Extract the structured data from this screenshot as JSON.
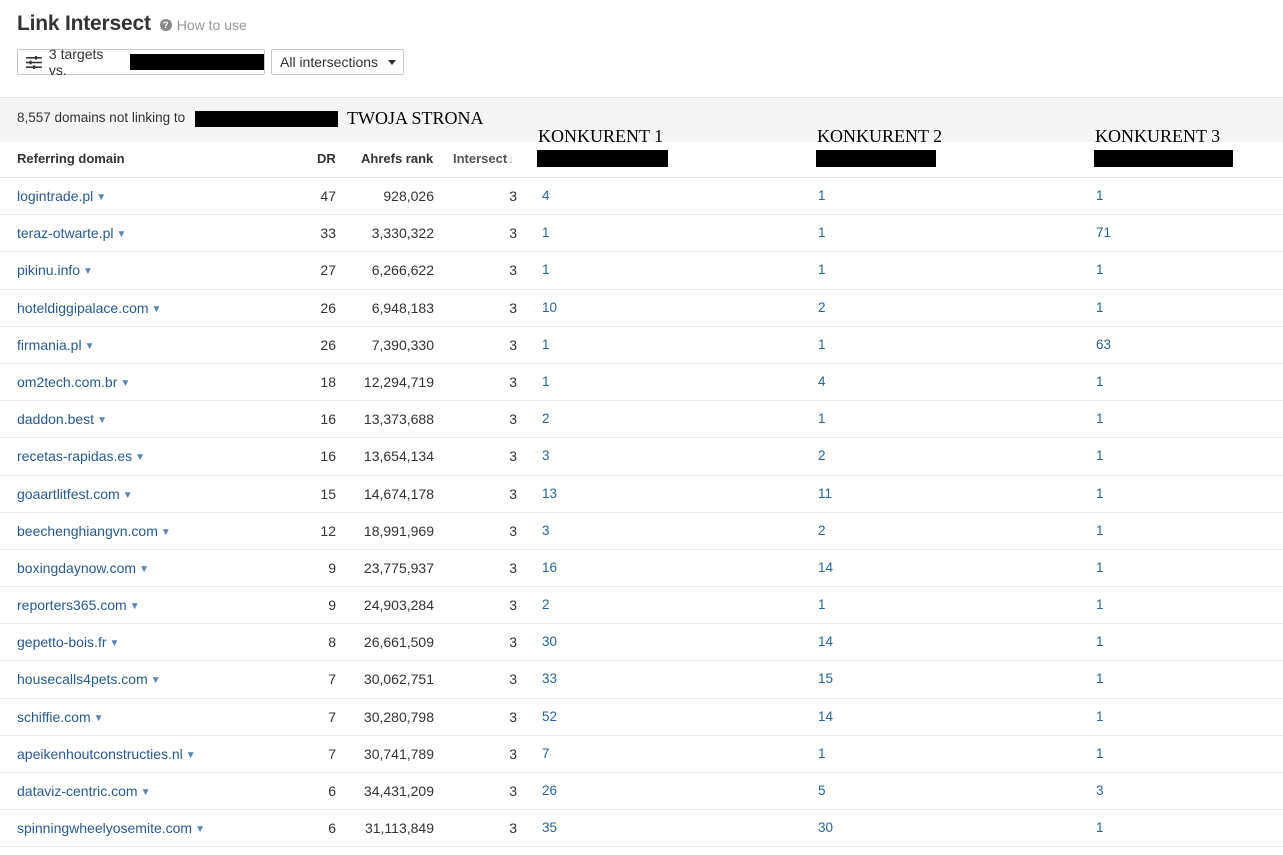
{
  "header": {
    "title": "Link Intersect",
    "help_icon": "?",
    "help_label": "How to use"
  },
  "toolbar": {
    "targets_label": "3 targets vs.",
    "filter_label": "All intersections"
  },
  "summary": {
    "text": "8,557 domains not linking to",
    "own_site_label": "TWOJA STRONA"
  },
  "competitors": [
    "KONKURENT 1",
    "KONKURENT 2",
    "KONKURENT 3"
  ],
  "columns": {
    "domain": "Referring domain",
    "dr": "DR",
    "rank": "Ahrefs rank",
    "intersect": "Intersect",
    "sort_glyph": "↓"
  },
  "rows": [
    {
      "domain": "logintrade.pl",
      "dr": "47",
      "rank": "928,026",
      "intersect": "3",
      "c1": "4",
      "c2": "1",
      "c3": "1"
    },
    {
      "domain": "teraz-otwarte.pl",
      "dr": "33",
      "rank": "3,330,322",
      "intersect": "3",
      "c1": "1",
      "c2": "1",
      "c3": "71"
    },
    {
      "domain": "pikinu.info",
      "dr": "27",
      "rank": "6,266,622",
      "intersect": "3",
      "c1": "1",
      "c2": "1",
      "c3": "1"
    },
    {
      "domain": "hoteldiggipalace.com",
      "dr": "26",
      "rank": "6,948,183",
      "intersect": "3",
      "c1": "10",
      "c2": "2",
      "c3": "1"
    },
    {
      "domain": "firmania.pl",
      "dr": "26",
      "rank": "7,390,330",
      "intersect": "3",
      "c1": "1",
      "c2": "1",
      "c3": "63"
    },
    {
      "domain": "om2tech.com.br",
      "dr": "18",
      "rank": "12,294,719",
      "intersect": "3",
      "c1": "1",
      "c2": "4",
      "c3": "1"
    },
    {
      "domain": "daddon.best",
      "dr": "16",
      "rank": "13,373,688",
      "intersect": "3",
      "c1": "2",
      "c2": "1",
      "c3": "1"
    },
    {
      "domain": "recetas-rapidas.es",
      "dr": "16",
      "rank": "13,654,134",
      "intersect": "3",
      "c1": "3",
      "c2": "2",
      "c3": "1"
    },
    {
      "domain": "goaartlitfest.com",
      "dr": "15",
      "rank": "14,674,178",
      "intersect": "3",
      "c1": "13",
      "c2": "11",
      "c3": "1"
    },
    {
      "domain": "beechenghiangvn.com",
      "dr": "12",
      "rank": "18,991,969",
      "intersect": "3",
      "c1": "3",
      "c2": "2",
      "c3": "1"
    },
    {
      "domain": "boxingdaynow.com",
      "dr": "9",
      "rank": "23,775,937",
      "intersect": "3",
      "c1": "16",
      "c2": "14",
      "c3": "1"
    },
    {
      "domain": "reporters365.com",
      "dr": "9",
      "rank": "24,903,284",
      "intersect": "3",
      "c1": "2",
      "c2": "1",
      "c3": "1"
    },
    {
      "domain": "gepetto-bois.fr",
      "dr": "8",
      "rank": "26,661,509",
      "intersect": "3",
      "c1": "30",
      "c2": "14",
      "c3": "1"
    },
    {
      "domain": "housecalls4pets.com",
      "dr": "7",
      "rank": "30,062,751",
      "intersect": "3",
      "c1": "33",
      "c2": "15",
      "c3": "1"
    },
    {
      "domain": "schiffie.com",
      "dr": "7",
      "rank": "30,280,798",
      "intersect": "3",
      "c1": "52",
      "c2": "14",
      "c3": "1"
    },
    {
      "domain": "apeikenhoutconstructies.nl",
      "dr": "7",
      "rank": "30,741,789",
      "intersect": "3",
      "c1": "7",
      "c2": "1",
      "c3": "1"
    },
    {
      "domain": "dataviz-centric.com",
      "dr": "6",
      "rank": "34,431,209",
      "intersect": "3",
      "c1": "26",
      "c2": "5",
      "c3": "3"
    },
    {
      "domain": "spinningwheelyosemite.com",
      "dr": "6",
      "rank": "31,113,849",
      "intersect": "3",
      "c1": "35",
      "c2": "30",
      "c3": "1"
    }
  ]
}
